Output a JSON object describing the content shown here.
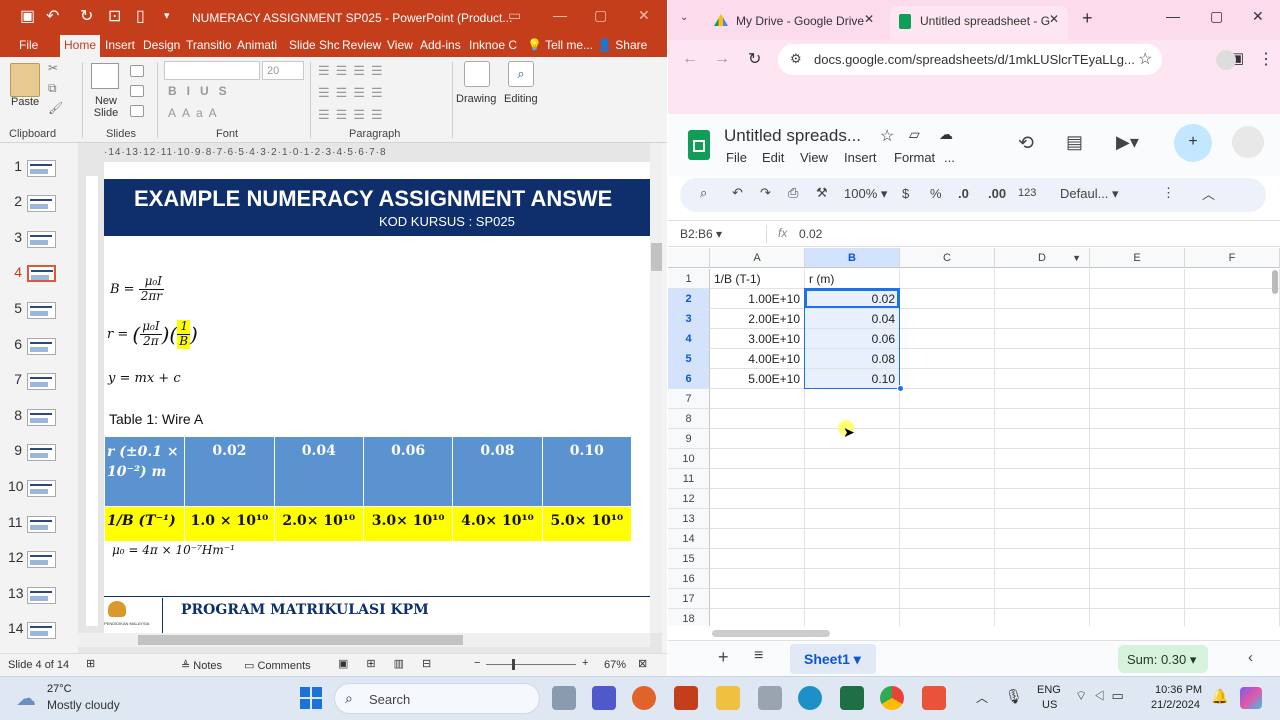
{
  "powerpoint": {
    "title": "NUMERACY ASSIGNMENT SP025 - PowerPoint (Product...",
    "tabs": [
      "File",
      "Home",
      "Insert",
      "Design",
      "Transitio",
      "Animati",
      "Slide Shc",
      "Review",
      "View",
      "Add-ins",
      "Inknoe C",
      "Tell me...",
      "Share"
    ],
    "active_tab": "Home",
    "ribbon": {
      "paste": "Paste",
      "new_slide": "New Slide",
      "font_size": "20",
      "drawing": "Drawing",
      "editing": "Editing",
      "groups": [
        "Clipboard",
        "Slides",
        "Font",
        "Paragraph"
      ]
    },
    "ruler": "·14·13·12·11·10·9·8·7·6·5·4·3·2·1·0·1·2·3·4·5·6·7·8",
    "thumbnails": [
      "1",
      "2",
      "3",
      "4",
      "5",
      "6",
      "7",
      "8",
      "9",
      "10",
      "11",
      "12",
      "13",
      "14"
    ],
    "active_slide": 4,
    "slide": {
      "title": "EXAMPLE NUMERACY ASSIGNMENT ANSWE",
      "subtitle": "KOD KURSUS : SP025",
      "eq1_lhs": "B =",
      "eq1_num": "μ₀I",
      "eq1_den": "2πr",
      "eq2_lhs": "r =",
      "eq2_num": "μ₀I",
      "eq2_den": "2π",
      "eq2_b_num": "1",
      "eq2_b_den": "B",
      "eq3": "y = mx + c",
      "table_caption": "Table 1: Wire A",
      "row1_header": "r (±0.1 × 10⁻²) m",
      "r_values": [
        "0.02",
        "0.04",
        "0.06",
        "0.08",
        "0.10"
      ],
      "row2_header": "1/B (T⁻¹)",
      "b_values": [
        "1.0 × 10¹⁰",
        "2.0× 10¹⁰",
        "3.0× 10¹⁰",
        "4.0× 10¹⁰",
        "5.0× 10¹⁰"
      ],
      "mu_note": "μ₀ = 4π × 10⁻⁷Hm⁻¹",
      "footer": "PROGRAM MATRIKULASI KPM",
      "footer_logo_text": "PENDIDIKAN MALAYSIA"
    },
    "status": {
      "slide_info": "Slide 4 of 14",
      "notes": "Notes",
      "comments": "Comments",
      "zoom": "67%"
    }
  },
  "chrome": {
    "tabs": [
      {
        "label": "My Drive - Google Drive"
      },
      {
        "label": "Untitled spreadsheet - G"
      }
    ],
    "url": "docs.google.com/spreadsheets/d/1mkLUSlcrTEyaLLg..."
  },
  "sheets": {
    "doc_title": "Untitled spreads...",
    "menus": [
      "File",
      "Edit",
      "View",
      "Insert",
      "Format",
      "..."
    ],
    "zoom": "100%",
    "font": "Defaul...",
    "toolbar_symbols": [
      "$",
      "%",
      ".0",
      ".00",
      "123"
    ],
    "name_box": "B2:B6",
    "formula_value": "0.02",
    "columns": [
      "A",
      "B",
      "C",
      "D",
      "E",
      "F"
    ],
    "rows": [
      "1",
      "2",
      "3",
      "4",
      "5",
      "6",
      "7",
      "8",
      "9",
      "10",
      "11",
      "12",
      "13",
      "14",
      "15",
      "16",
      "17",
      "18"
    ],
    "cells": {
      "A1": "1/B (T-1)",
      "B1": "r (m)",
      "A2": "1.00E+10",
      "B2": "0.02",
      "A3": "2.00E+10",
      "B3": "0.04",
      "A4": "3.00E+10",
      "B4": "0.06",
      "A5": "4.00E+10",
      "B5": "0.08",
      "A6": "5.00E+10",
      "B6": "0.10"
    },
    "sheet_tab": "Sheet1",
    "sum": "Sum: 0.30"
  },
  "taskbar": {
    "weather_temp": "27°C",
    "weather_desc": "Mostly cloudy",
    "search_placeholder": "Search",
    "lang": "ENG",
    "region": "US",
    "time": "10:36 PM",
    "date": "21/2/2024"
  },
  "colors": {
    "ppt_red": "#c43e1c",
    "slide_navy": "#0e2f6b",
    "table_blue": "#5b93d0",
    "table_yellow": "#ffff00",
    "chrome_pink": "#fcdcec",
    "sheets_green": "#0f9d58",
    "selection_blue": "#1a73e8"
  }
}
